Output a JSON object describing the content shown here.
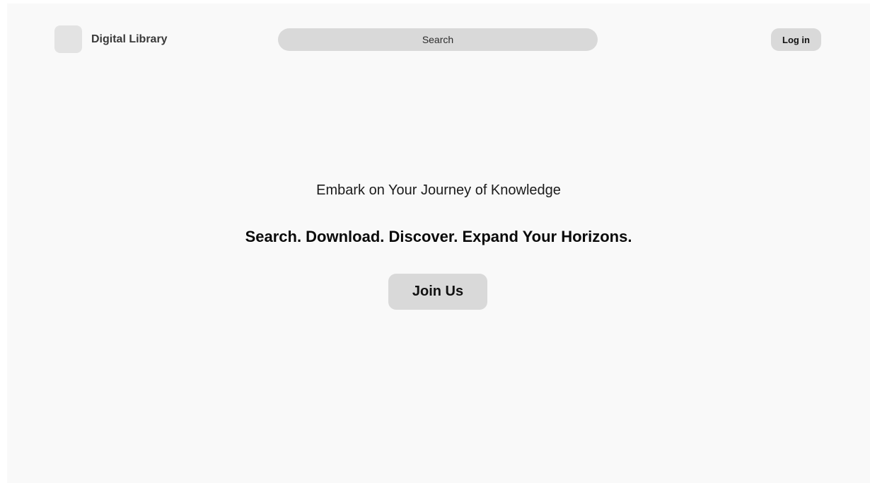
{
  "header": {
    "brand": {
      "logo_icon": "logo-placeholder-icon",
      "name": "Digital Library"
    },
    "search": {
      "placeholder": "Search",
      "value": ""
    },
    "login_label": "Log in"
  },
  "hero": {
    "tagline": "Embark on Your Journey of Knowledge",
    "headline": "Search. Download. Discover. Expand Your Horizons.",
    "cta_label": "Join Us"
  },
  "colors": {
    "background": "#f9f9f9",
    "control_fill": "#d9d9d9",
    "logo_fill": "#e3e3e3",
    "text_primary": "#111111"
  }
}
